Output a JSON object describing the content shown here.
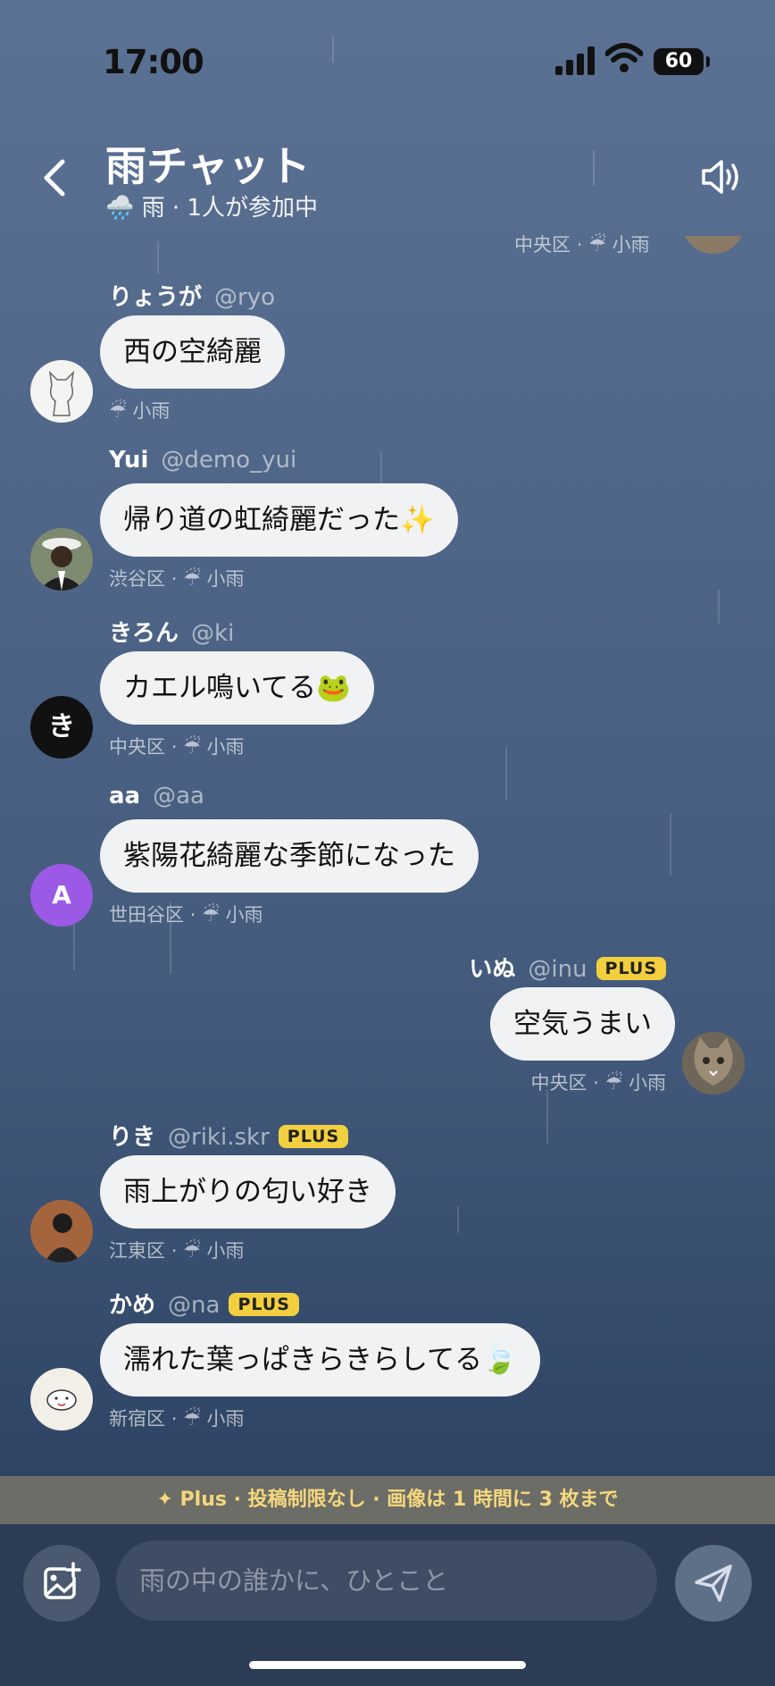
{
  "status_bar": {
    "time": "17:00",
    "battery": "60"
  },
  "header": {
    "title": "雨チャット",
    "weather_icon": "🌧️",
    "subtitle": "雨 · 1人が参加中"
  },
  "top_cut_meta": {
    "location": "中央区",
    "weather": "小雨"
  },
  "messages": [
    {
      "name": "りょうが",
      "handle": "@ryo",
      "text": "西の空綺麗",
      "location": "",
      "weather": "小雨",
      "avatar_label": ""
    },
    {
      "name": "Yui",
      "handle": "@demo_yui",
      "text": "帰り道の虹綺麗だった✨",
      "location": "渋谷区",
      "weather": "小雨",
      "avatar_label": ""
    },
    {
      "name": "きろん",
      "handle": "@ki",
      "text": "カエル鳴いてる🐸",
      "location": "中央区",
      "weather": "小雨",
      "avatar_label": "き"
    },
    {
      "name": "aa",
      "handle": "@aa",
      "text": "紫陽花綺麗な季節になった",
      "location": "世田谷区",
      "weather": "小雨",
      "avatar_label": "A"
    },
    {
      "name": "いぬ",
      "handle": "@inu",
      "badge": "PLUS",
      "text": "空気うまい",
      "location": "中央区",
      "weather": "小雨",
      "avatar_label": ""
    },
    {
      "name": "りき",
      "handle": "@riki.skr",
      "badge": "PLUS",
      "text": "雨上がりの匂い好き",
      "location": "江東区",
      "weather": "小雨",
      "avatar_label": ""
    },
    {
      "name": "かめ",
      "handle": "@na",
      "badge": "PLUS",
      "text": "濡れた葉っぱきらきらしてる🍃",
      "location": "新宿区",
      "weather": "小雨",
      "avatar_label": ""
    }
  ],
  "meta_separator": "·",
  "umbrella_icon": "☔",
  "banner": "✦ Plus · 投稿制限なし · 画像は 1 時間に 3 枚まで",
  "composer": {
    "placeholder": "雨の中の誰かに、ひとこと"
  },
  "colors": {
    "bubble": "#f1f2f4",
    "plus_badge": "#f2cf3f",
    "banner_text": "#f5d77d",
    "avatar_aa": "#9b59e6"
  }
}
